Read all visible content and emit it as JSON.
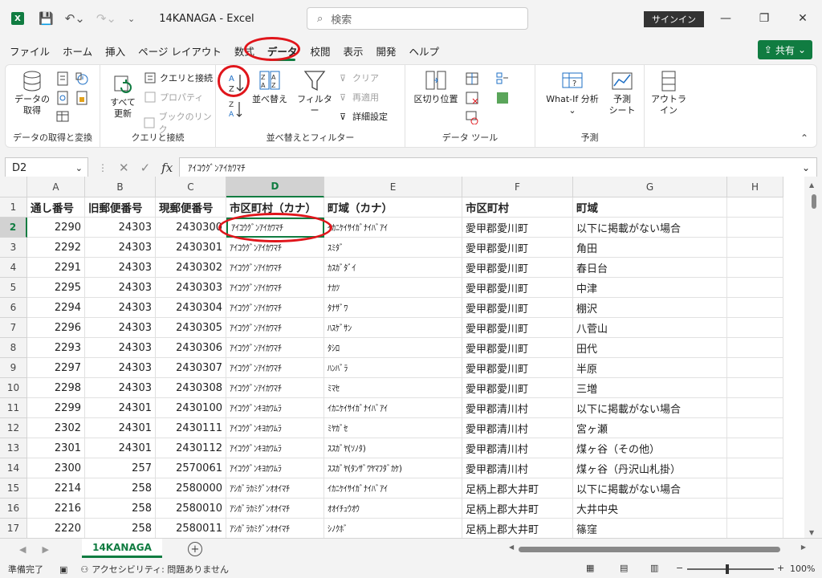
{
  "title": {
    "app_letter": "X",
    "doc": "14KANAGA  -  Excel",
    "search_placeholder": "検索",
    "signin": "サインイン"
  },
  "tabs": [
    "ファイル",
    "ホーム",
    "挿入",
    "ページ レイアウト",
    "数式",
    "データ",
    "校閲",
    "表示",
    "開発",
    "ヘルプ"
  ],
  "active_tab": "データ",
  "share": "共有",
  "ribbon": {
    "get_data": "データの\n取得",
    "refresh_all": "すべて\n更新",
    "queries": "クエリと接続",
    "properties": "プロパティ",
    "edit_links": "ブックのリンク",
    "group1": "データの取得と変換",
    "group2": "クエリと接続",
    "sort": "並べ替え",
    "filter": "フィルター",
    "clear": "クリア",
    "reapply": "再適用",
    "advanced": "詳細設定",
    "group3": "並べ替えとフィルター",
    "text_to_columns": "区切り位置",
    "group4": "データ ツール",
    "whatif": "What-If 分析",
    "forecast": "予測\nシート",
    "group5": "予測",
    "outline": "アウトラ\nイン"
  },
  "formula": {
    "namebox": "D2",
    "value": "ｱｲｺｳｸﾞﾝｱｲｶﾜﾏﾁ"
  },
  "columns": [
    "A",
    "B",
    "C",
    "D",
    "E",
    "F",
    "G",
    "H"
  ],
  "header_row": [
    "通し番号",
    "旧郵便番号",
    "現郵便番号",
    "市区町村（カナ）",
    "町域（カナ）",
    "市区町村",
    "町域",
    ""
  ],
  "rows": [
    [
      "2290",
      "24303",
      "2430300",
      "ｱｲｺｳｸﾞﾝｱｲｶﾜﾏﾁ",
      "ｲｶﾆｹｲｻｲｶﾞﾅｲﾊﾞｱｲ",
      "愛甲郡愛川町",
      "以下に掲載がない場合"
    ],
    [
      "2292",
      "24303",
      "2430301",
      "ｱｲｺｳｸﾞﾝｱｲｶﾜﾏﾁ",
      "ｽﾐﾀﾞ",
      "愛甲郡愛川町",
      "角田"
    ],
    [
      "2291",
      "24303",
      "2430302",
      "ｱｲｺｳｸﾞﾝｱｲｶﾜﾏﾁ",
      "ｶｽｶﾞﾀﾞｲ",
      "愛甲郡愛川町",
      "春日台"
    ],
    [
      "2295",
      "24303",
      "2430303",
      "ｱｲｺｳｸﾞﾝｱｲｶﾜﾏﾁ",
      "ﾅｶﾂ",
      "愛甲郡愛川町",
      "中津"
    ],
    [
      "2294",
      "24303",
      "2430304",
      "ｱｲｺｳｸﾞﾝｱｲｶﾜﾏﾁ",
      "ﾀﾅｻﾞﾜ",
      "愛甲郡愛川町",
      "棚沢"
    ],
    [
      "2296",
      "24303",
      "2430305",
      "ｱｲｺｳｸﾞﾝｱｲｶﾜﾏﾁ",
      "ﾊｽｹﾞｻﾝ",
      "愛甲郡愛川町",
      "八菅山"
    ],
    [
      "2293",
      "24303",
      "2430306",
      "ｱｲｺｳｸﾞﾝｱｲｶﾜﾏﾁ",
      "ﾀｼﾛ",
      "愛甲郡愛川町",
      "田代"
    ],
    [
      "2297",
      "24303",
      "2430307",
      "ｱｲｺｳｸﾞﾝｱｲｶﾜﾏﾁ",
      "ﾊﾝﾊﾞﾗ",
      "愛甲郡愛川町",
      "半原"
    ],
    [
      "2298",
      "24303",
      "2430308",
      "ｱｲｺｳｸﾞﾝｱｲｶﾜﾏﾁ",
      "ﾐﾏｾ",
      "愛甲郡愛川町",
      "三増"
    ],
    [
      "2299",
      "24301",
      "2430100",
      "ｱｲｺｳｸﾞﾝｷﾖｶﾜﾑﾗ",
      "ｲｶﾆｹｲｻｲｶﾞﾅｲﾊﾞｱｲ",
      "愛甲郡清川村",
      "以下に掲載がない場合"
    ],
    [
      "2302",
      "24301",
      "2430111",
      "ｱｲｺｳｸﾞﾝｷﾖｶﾜﾑﾗ",
      "ﾐﾔｶﾞｾ",
      "愛甲郡清川村",
      "宮ヶ瀬"
    ],
    [
      "2301",
      "24301",
      "2430112",
      "ｱｲｺｳｸﾞﾝｷﾖｶﾜﾑﾗ",
      "ｽｽｶﾞﾔ(ｿﾉﾀ)",
      "愛甲郡清川村",
      "煤ヶ谷（その他）"
    ],
    [
      "2300",
      "257",
      "2570061",
      "ｱｲｺｳｸﾞﾝｷﾖｶﾜﾑﾗ",
      "ｽｽｶﾞﾔ(ﾀﾝｻﾞﾜﾔﾏﾌﾀﾞｶｹ)",
      "愛甲郡清川村",
      "煤ヶ谷（丹沢山札掛）"
    ],
    [
      "2214",
      "258",
      "2580000",
      "ｱｼｶﾞﾗｶﾐｸﾞﾝｵｵｲﾏﾁ",
      "ｲｶﾆｹｲｻｲｶﾞﾅｲﾊﾞｱｲ",
      "足柄上郡大井町",
      "以下に掲載がない場合"
    ],
    [
      "2216",
      "258",
      "2580010",
      "ｱｼｶﾞﾗｶﾐｸﾞﾝｵｵｲﾏﾁ",
      "ｵｵｲﾁｭｳｵｳ",
      "足柄上郡大井町",
      "大井中央"
    ],
    [
      "2220",
      "258",
      "2580011",
      "ｱｼｶﾞﾗｶﾐｸﾞﾝｵｵｲﾏﾁ",
      "ｼﾉｸﾎﾞ",
      "足柄上郡大井町",
      "篠窪"
    ]
  ],
  "sheet": "14KANAGA",
  "status": {
    "ready": "準備完了",
    "accessibility": "アクセシビリティ: 問題ありません",
    "zoom": "100%"
  },
  "colors": {
    "accent": "#107c41",
    "annotation": "#e0151b"
  }
}
